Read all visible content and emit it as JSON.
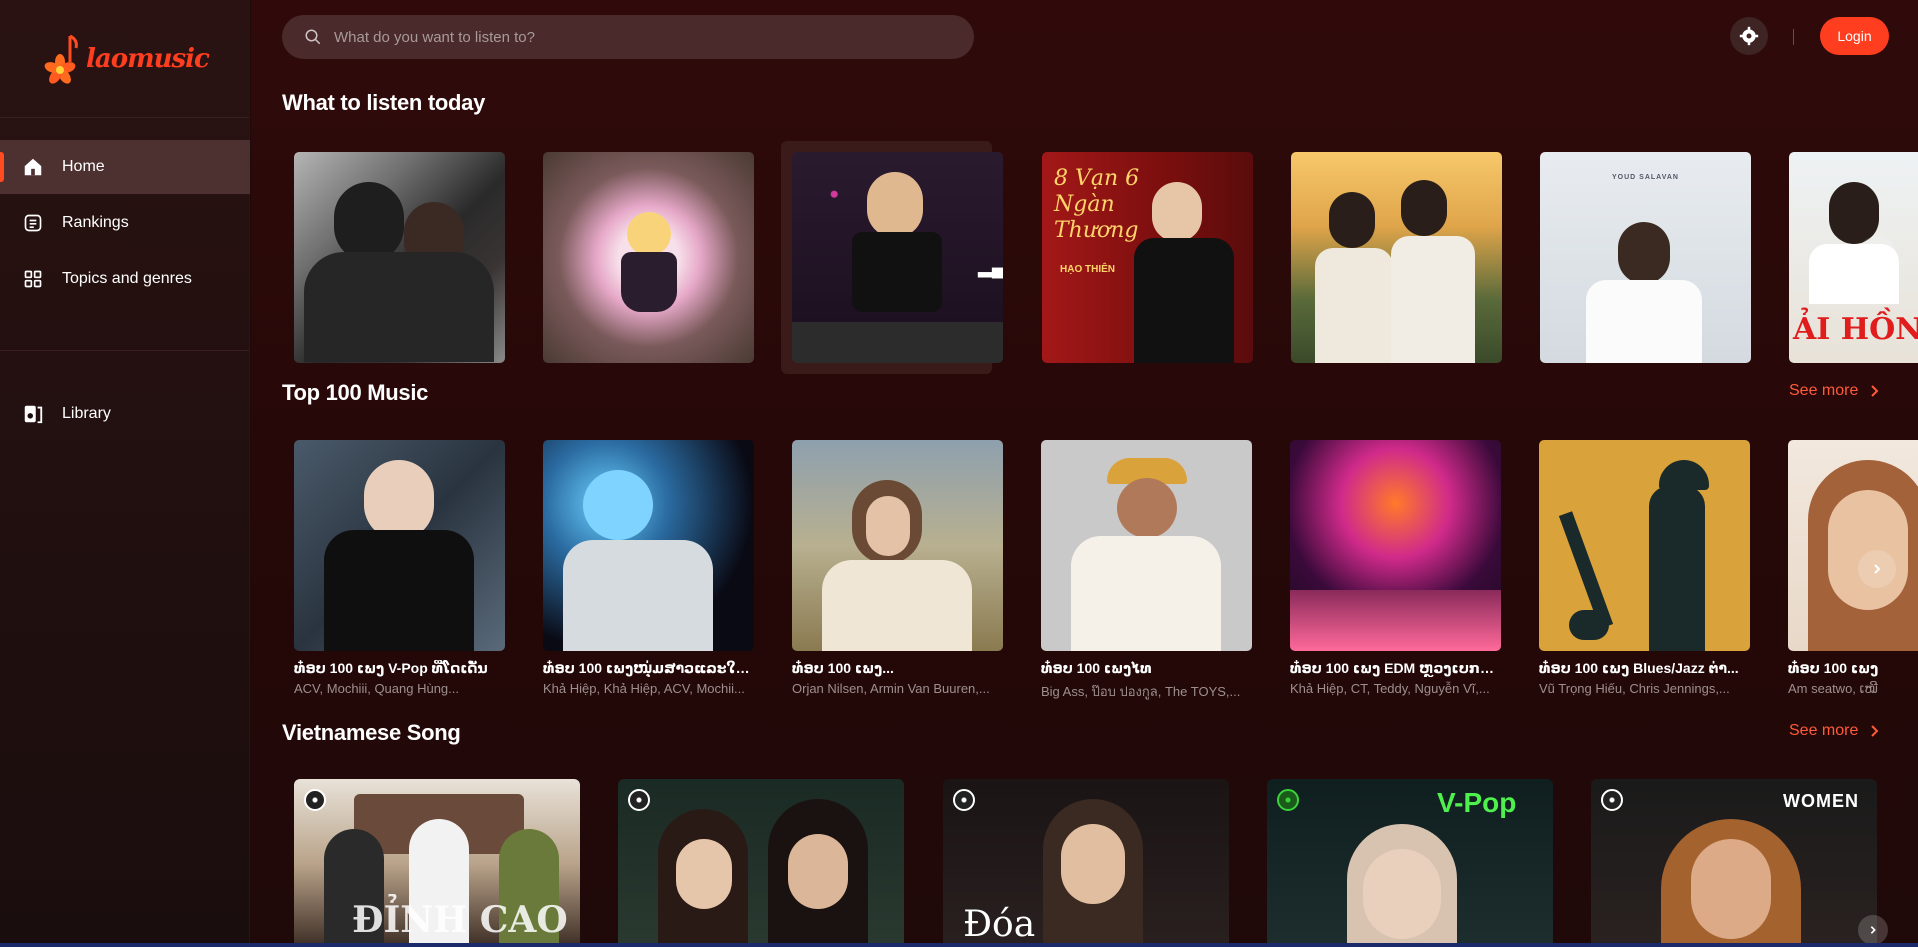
{
  "app": {
    "logo_text": "laomusic"
  },
  "search": {
    "placeholder": "What do you want to listen to?"
  },
  "header": {
    "login_label": "Login"
  },
  "sidebar": {
    "items": [
      {
        "label": "Home",
        "icon": "home-icon",
        "active": true
      },
      {
        "label": "Rankings",
        "icon": "rankings-icon"
      },
      {
        "label": "Topics and genres",
        "icon": "grid-icon"
      }
    ],
    "library_label": "Library"
  },
  "sections": {
    "today": {
      "title": "What to listen today"
    },
    "top100": {
      "title": "Top 100 Music",
      "see_more": "See more"
    },
    "vietnamese": {
      "title": "Vietnamese Song",
      "see_more": "See more"
    }
  },
  "top100_cards": [
    {
      "title": "ທ໋ອບ 100 ເພງ V-Pop ທີ່ໂດເດັ່ນ",
      "subtitle": "ACV, Mochiii, Quang Hùng..."
    },
    {
      "title": "ທ໋ອບ 100 ເພງໜຸ່ມສາວແລະໃຈ...",
      "subtitle": "Khả Hiệp, Khả Hiệp, ACV, Mochii..."
    },
    {
      "title": "ທ໋ອບ 100 ເພງ...",
      "subtitle": "Orjan Nilsen, Armin Van Buuren,..."
    },
    {
      "title": "ທ໋ອບ 100 ເພງໄທ",
      "subtitle": "Big Ass, ป๊อบ ปองกูล, The TOYS,..."
    },
    {
      "title": "ທ໋ອບ 100 ເພງ EDM ຫຼວງເບກສ...",
      "subtitle": "Khả Hiệp, CT, Teddy, Nguyễn Vĩ,..."
    },
    {
      "title": "ທ໋ອບ 100 ເພງ Blues/Jazz ຕ່າ...",
      "subtitle": "Vũ Trọng Hiếu, Chris Jennings,..."
    },
    {
      "title": "ທ໋ອບ 100 ເພງ ",
      "subtitle": "Am seatwo, ເໝີ"
    }
  ],
  "vietnamese_cards": [
    {
      "overlay": "ĐỈNH CAO"
    },
    {
      "overlay": ""
    },
    {
      "overlay": "Đóa"
    },
    {
      "overlay": "V-Pop"
    },
    {
      "overlay": "WOMEN"
    }
  ],
  "today_cards": [
    {
      "overlay": ""
    },
    {
      "overlay": ""
    },
    {
      "overlay": ""
    },
    {
      "overlay": "8 Vạn 6 Ngàn Thương",
      "sub_overlay": "HẠO THIÊN"
    },
    {
      "overlay": ""
    },
    {
      "overlay": "YOUD SALAVAN"
    },
    {
      "overlay": "ẢI HỒN"
    }
  ],
  "colors": {
    "accent": "#ff3d1f",
    "sidebar_active": "#4d3030",
    "background": "#260808"
  }
}
